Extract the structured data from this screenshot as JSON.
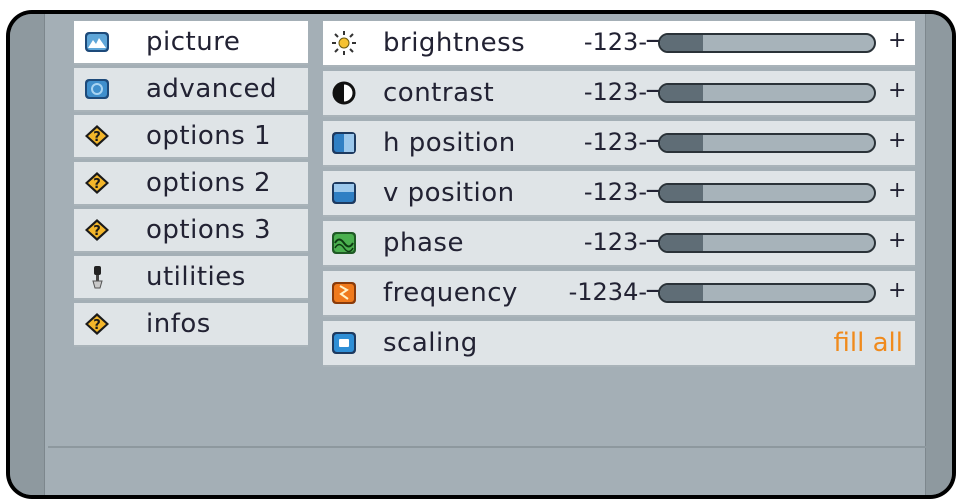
{
  "menu": {
    "items": [
      {
        "label": "picture",
        "icon": "picture-icon",
        "active": true
      },
      {
        "label": "advanced",
        "icon": "advanced-icon",
        "active": false
      },
      {
        "label": "options 1",
        "icon": "question-icon",
        "active": false
      },
      {
        "label": "options 2",
        "icon": "question-icon",
        "active": false
      },
      {
        "label": "options 3",
        "icon": "question-icon",
        "active": false
      },
      {
        "label": "utilities",
        "icon": "wrench-icon",
        "active": false
      },
      {
        "label": "infos",
        "icon": "question-icon",
        "active": false
      }
    ]
  },
  "picture": {
    "rows": [
      {
        "label": "brightness",
        "icon": "sun-icon",
        "value": "-123-",
        "minus": "−",
        "plus": "+",
        "level": 0.2
      },
      {
        "label": "contrast",
        "icon": "contrast-icon",
        "value": "-123-",
        "minus": "−",
        "plus": "+",
        "level": 0.2
      },
      {
        "label": "h position",
        "icon": "h-position-icon",
        "value": "-123-",
        "minus": "−",
        "plus": "+",
        "level": 0.2
      },
      {
        "label": "v position",
        "icon": "v-position-icon",
        "value": "-123-",
        "minus": "−",
        "plus": "+",
        "level": 0.2
      },
      {
        "label": "phase",
        "icon": "phase-icon",
        "value": "-123-",
        "minus": "−",
        "plus": "+",
        "level": 0.2
      },
      {
        "label": "frequency",
        "icon": "frequency-icon",
        "value": "-1234-",
        "minus": "−",
        "plus": "+",
        "level": 0.2
      }
    ],
    "scaling": {
      "label": "scaling",
      "icon": "scaling-icon",
      "value": "fill all"
    }
  },
  "colors": {
    "background": "#a4afb6",
    "item": "#dfe4e7",
    "active_item": "#ffffff",
    "slider_track": "#a7b3ba",
    "slider_fill": "#5f6d76",
    "accent_orange": "#f08a1c"
  }
}
